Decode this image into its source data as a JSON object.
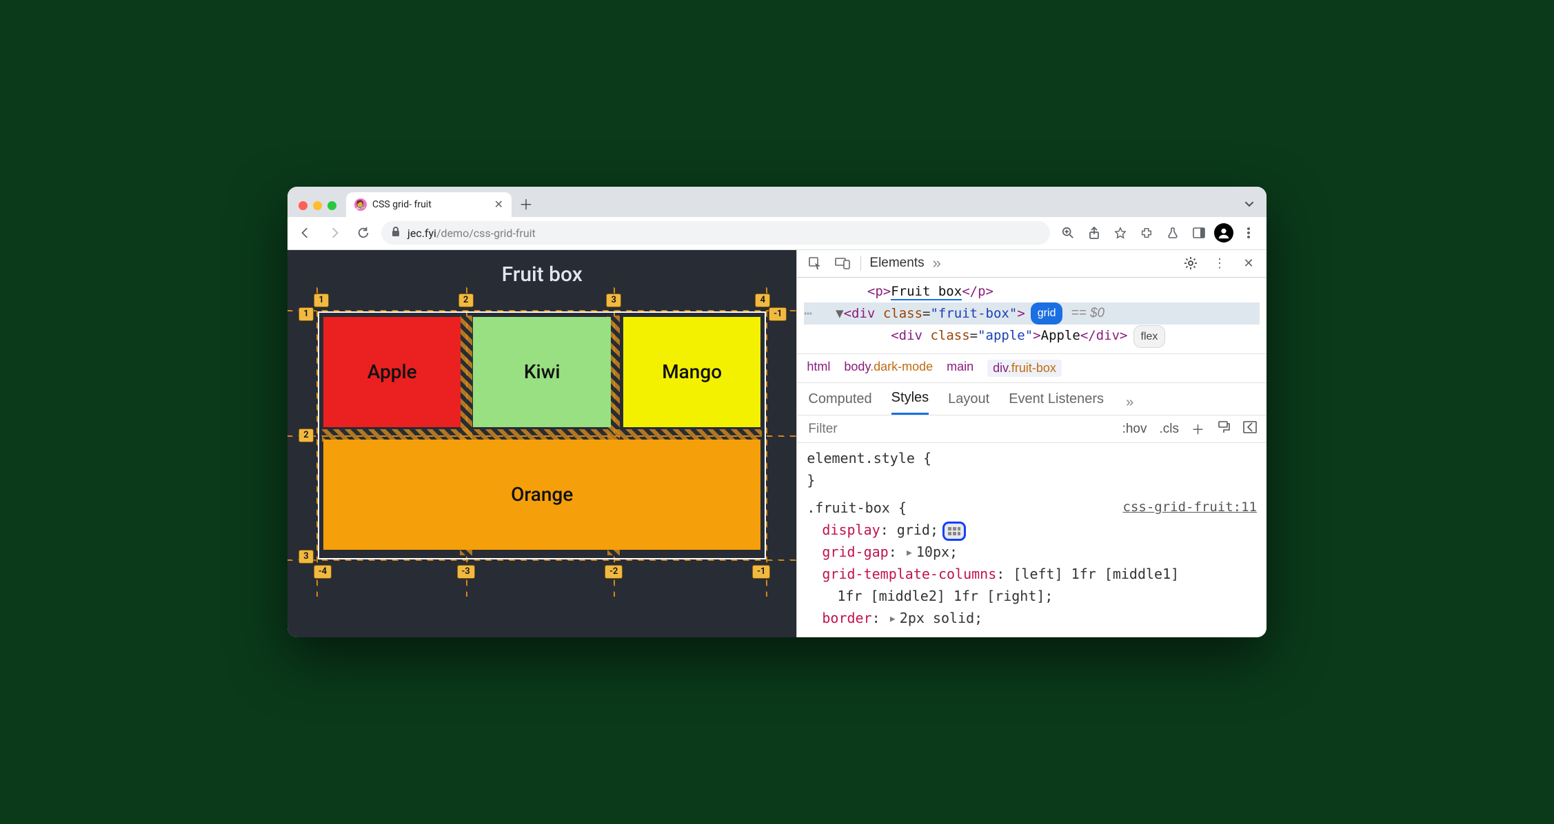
{
  "tabbar": {
    "title": "CSS grid- fruit"
  },
  "toolbar": {
    "url_host": "jec.fyi",
    "url_path": "/demo/css-grid-fruit"
  },
  "page": {
    "heading": "Fruit box",
    "cells": {
      "apple": "Apple",
      "kiwi": "Kiwi",
      "mango": "Mango",
      "orange": "Orange"
    },
    "col_labels": [
      "1",
      "2",
      "3",
      "4"
    ],
    "row_labels_left": [
      "1",
      "2",
      "3"
    ],
    "row_labels_right_top": "-1",
    "neg_bottom": [
      "-4",
      "-3",
      "-2",
      "-1"
    ]
  },
  "devtools": {
    "panel_tab": "Elements",
    "dom": {
      "p_text": "Fruit box",
      "div_class": "fruit-box",
      "grid_badge": "grid",
      "eq": "== $0",
      "child_class": "apple",
      "child_text": "Apple",
      "flex_badge": "flex"
    },
    "breadcrumb": [
      "html",
      "body.dark-mode",
      "main",
      "div.fruit-box"
    ],
    "side_tabs": [
      "Computed",
      "Styles",
      "Layout",
      "Event Listeners"
    ],
    "filter": {
      "placeholder": "Filter",
      "hov": ":hov",
      "cls": ".cls"
    },
    "styles": {
      "element_style": "element.style {",
      "close": "}",
      "selector": ".fruit-box {",
      "source": "css-grid-fruit:11",
      "props": {
        "display": {
          "name": "display",
          "value": "grid"
        },
        "gap": {
          "name": "grid-gap",
          "value": "10px"
        },
        "cols": {
          "name": "grid-template-columns",
          "value": "[left] 1fr [middle1] 1fr [middle2] 1fr [right]"
        },
        "border": {
          "name": "border",
          "value": "2px solid"
        }
      }
    }
  }
}
